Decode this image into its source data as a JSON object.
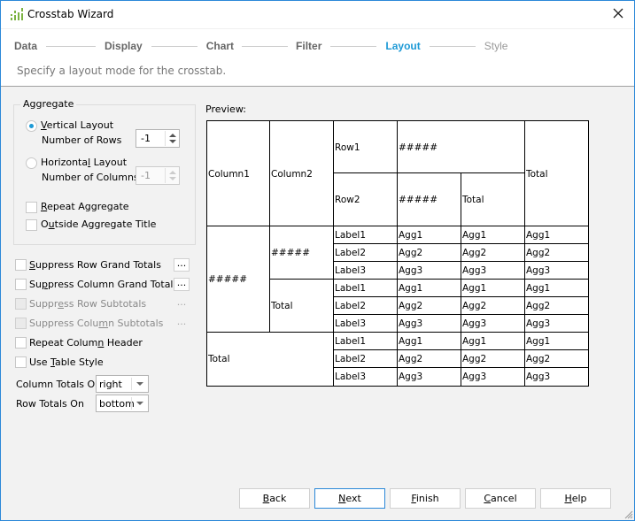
{
  "window": {
    "title": "Crosstab Wizard",
    "app_icon": "crosstab-icon",
    "close_icon": "close-icon"
  },
  "steps": [
    {
      "label": "Data",
      "state": "done"
    },
    {
      "label": "Display",
      "state": "done"
    },
    {
      "label": "Chart",
      "state": "done"
    },
    {
      "label": "Filter",
      "state": "done"
    },
    {
      "label": "Layout",
      "state": "active"
    },
    {
      "label": "Style",
      "state": "future"
    }
  ],
  "subtitle": "Specify a layout mode for the crosstab.",
  "aggregate": {
    "group_label": "Aggregate",
    "vertical_layout": {
      "label_pre": "",
      "label_ul": "V",
      "label_post": "ertical Layout",
      "checked": true
    },
    "number_of_rows": {
      "label": "Number of Rows",
      "value": "-1"
    },
    "horizontal_layout": {
      "label_pre": "Horizonta",
      "label_ul": "l",
      "label_post": " Layout",
      "checked": false
    },
    "number_of_columns": {
      "label": "Number of Columns",
      "value": "-1"
    },
    "repeat_aggregate": {
      "label_pre": "",
      "label_ul": "R",
      "label_post": "epeat Aggregate",
      "checked": false
    },
    "outside_title": {
      "label_pre": "O",
      "label_ul": "u",
      "label_post": "tside Aggregate Title",
      "checked": false
    }
  },
  "options": {
    "suppress_row_grand": {
      "label_pre": "",
      "label_ul": "S",
      "label_post": "uppress Row Grand Totals",
      "checked": false,
      "more": "..."
    },
    "suppress_col_grand": {
      "label_pre": "Su",
      "label_ul": "p",
      "label_post": "press Column Grand Totals",
      "checked": false,
      "more": "..."
    },
    "suppress_row_sub": {
      "label_pre": "Suppr",
      "label_ul": "e",
      "label_post": "ss Row Subtotals",
      "checked": false,
      "disabled": true,
      "more": "..."
    },
    "suppress_col_sub": {
      "label_pre": "Suppress Colu",
      "label_ul": "m",
      "label_post": "n Subtotals",
      "checked": false,
      "disabled": true,
      "more": "..."
    },
    "repeat_col_header": {
      "label_pre": "Repeat Colum",
      "label_ul": "n",
      "label_post": " Header",
      "checked": false
    },
    "use_table_style": {
      "label_pre": "Use ",
      "label_ul": "T",
      "label_post": "able Style",
      "checked": false
    },
    "column_totals_on": {
      "label": "Column Totals On",
      "value": "right"
    },
    "row_totals_on": {
      "label": "Row Totals On",
      "value": "bottom"
    }
  },
  "preview": {
    "label": "Preview:",
    "header": {
      "column1": "Column1",
      "column2": "Column2",
      "row1": "Row1",
      "row2": "Row2",
      "row1_value": "#####",
      "row2_value": "#####",
      "row2_total": "Total",
      "grand_total": "Total"
    },
    "groups": [
      {
        "outer": "#####",
        "inner": [
          {
            "label": "#####",
            "rows": [
              [
                "Label1",
                "Agg1",
                "Agg1",
                "Agg1"
              ],
              [
                "Label2",
                "Agg2",
                "Agg2",
                "Agg2"
              ],
              [
                "Label3",
                "Agg3",
                "Agg3",
                "Agg3"
              ]
            ]
          },
          {
            "label": "Total",
            "rows": [
              [
                "Label1",
                "Agg1",
                "Agg1",
                "Agg1"
              ],
              [
                "Label2",
                "Agg2",
                "Agg2",
                "Agg2"
              ],
              [
                "Label3",
                "Agg3",
                "Agg3",
                "Agg3"
              ]
            ]
          }
        ]
      },
      {
        "outer": "Total",
        "inner": [
          {
            "label": "",
            "rows": [
              [
                "Label1",
                "Agg1",
                "Agg1",
                "Agg1"
              ],
              [
                "Label2",
                "Agg2",
                "Agg2",
                "Agg2"
              ],
              [
                "Label3",
                "Agg3",
                "Agg3",
                "Agg3"
              ]
            ]
          }
        ]
      }
    ]
  },
  "buttons": {
    "back": {
      "pre": "",
      "ul": "B",
      "post": "ack"
    },
    "next": {
      "pre": "",
      "ul": "N",
      "post": "ext"
    },
    "finish": {
      "pre": "",
      "ul": "F",
      "post": "inish"
    },
    "cancel": {
      "pre": "",
      "ul": "C",
      "post": "ancel"
    },
    "help": {
      "pre": "",
      "ul": "H",
      "post": "elp"
    }
  },
  "colors": {
    "accent": "#1e9ad6",
    "window_border": "#2b88d8",
    "icon_green": "#7cb342"
  }
}
